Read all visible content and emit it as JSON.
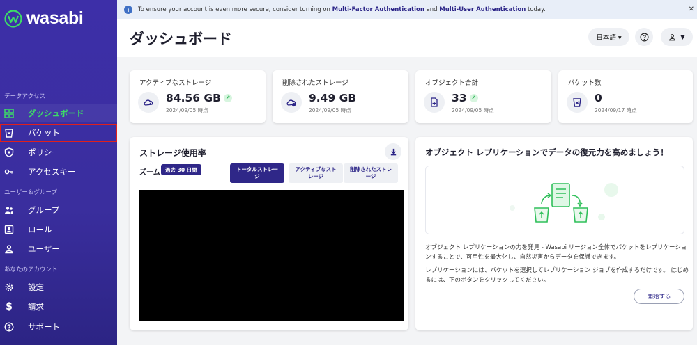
{
  "brand": {
    "name": "wasabi"
  },
  "banner": {
    "prefix": "To ensure your account is even more secure, consider turning on ",
    "mfa": "Multi-Factor Authentication",
    "and": " and ",
    "mua": "Multi-User Authentication",
    "suffix": " today."
  },
  "sidebar": {
    "sections": [
      {
        "label": "データアクセス"
      },
      {
        "label": "ユーザー＆グループ"
      },
      {
        "label": "あなたのアカウント"
      }
    ],
    "items": [
      {
        "label": "ダッシュボード",
        "icon": "dashboard-icon"
      },
      {
        "label": "バケット",
        "icon": "bucket-icon"
      },
      {
        "label": "ポリシー",
        "icon": "shield-icon"
      },
      {
        "label": "アクセスキー",
        "icon": "key-icon"
      },
      {
        "label": "グループ",
        "icon": "group-icon"
      },
      {
        "label": "ロール",
        "icon": "role-icon"
      },
      {
        "label": "ユーザー",
        "icon": "user-icon"
      },
      {
        "label": "設定",
        "icon": "gear-icon"
      },
      {
        "label": "請求",
        "icon": "dollar-icon"
      },
      {
        "label": "サポート",
        "icon": "help-icon"
      }
    ]
  },
  "header": {
    "title": "ダッシュボード",
    "language": "日本語 ▾"
  },
  "stats": [
    {
      "title": "アクティブなストレージ",
      "value": "84.56 GB",
      "date": "2024/09/05 時点",
      "trend": "↗"
    },
    {
      "title": "削除されたストレージ",
      "value": "9.49 GB",
      "date": "2024/09/05 時点"
    },
    {
      "title": "オブジェクト合計",
      "value": "33",
      "date": "2024/09/05 時点",
      "trend": "↗"
    },
    {
      "title": "バケット数",
      "value": "0",
      "date": "2024/09/17 時点"
    }
  ],
  "usage": {
    "title": "ストレージ使用率",
    "zoom_label": "ズーム",
    "zoom_value": "過去 30 日間",
    "tabs": [
      {
        "label": "トータルストレージ"
      },
      {
        "label": "アクティブなストレージ"
      },
      {
        "label": "削除されたストレージ"
      }
    ]
  },
  "replication": {
    "title": "オブジェクト レプリケーションでデータの復元力を高めましょう！",
    "para1": "オブジェクト レプリケーションの力を発見 - Wasabi リージョン全体でバケットをレプリケーションすることで、可用性を最大化し、自然災害からデータを保護できます。",
    "para2": "レプリケーションには、バケットを選択してレプリケーション ジョブを作成するだけです。 はじめるには、下のボタンをクリックしてください。",
    "button": "開始する"
  },
  "colors": {
    "sidebar": "#3d2fa8",
    "accent_green": "#3ddc67",
    "primary": "#2f2788",
    "highlight_border": "#e0201c"
  }
}
